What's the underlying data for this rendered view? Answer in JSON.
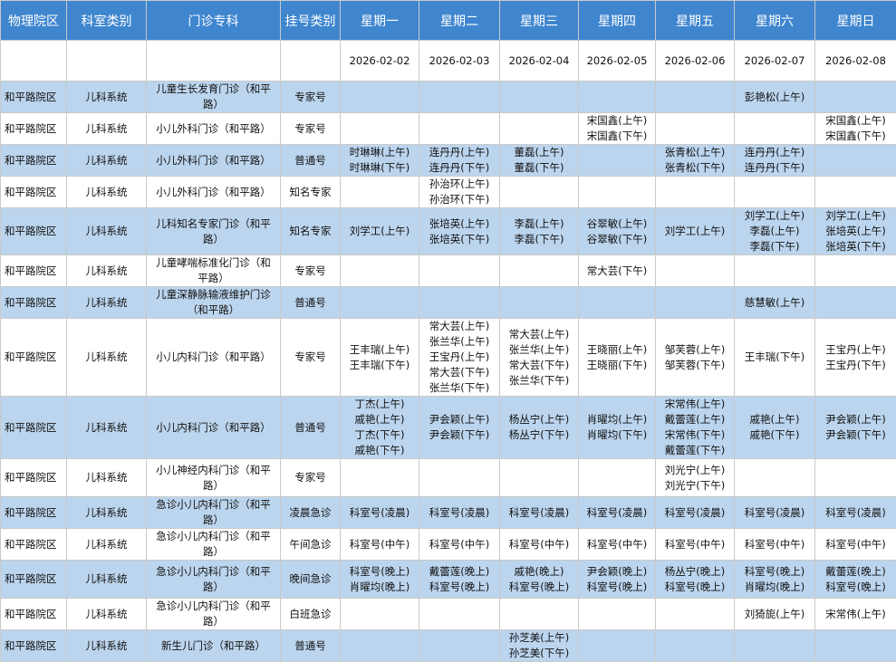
{
  "headers": [
    "物理院区",
    "科室类别",
    "门诊专科",
    "挂号类别",
    "星期一",
    "星期二",
    "星期三",
    "星期四",
    "星期五",
    "星期六",
    "星期日"
  ],
  "dates": [
    "2026-02-02",
    "2026-02-03",
    "2026-02-04",
    "2026-02-05",
    "2026-02-06",
    "2026-02-07",
    "2026-02-08"
  ],
  "rows": [
    {
      "site": "和平路院区",
      "cat": "儿科系统",
      "clinic": "儿童生长发育门诊（和平路）",
      "reg": "专家号",
      "slots": [
        [],
        [],
        [],
        [],
        [],
        [
          "彭艳松(上午)"
        ],
        []
      ]
    },
    {
      "site": "和平路院区",
      "cat": "儿科系统",
      "clinic": "小儿外科门诊（和平路）",
      "reg": "专家号",
      "slots": [
        [],
        [],
        [],
        [
          "宋国鑫(上午)",
          "宋国鑫(下午)"
        ],
        [],
        [],
        [
          "宋国鑫(上午)",
          "宋国鑫(下午)"
        ]
      ]
    },
    {
      "site": "和平路院区",
      "cat": "儿科系统",
      "clinic": "小儿外科门诊（和平路）",
      "reg": "普通号",
      "slots": [
        [
          "时琳琳(上午)",
          "时琳琳(下午)"
        ],
        [
          "连丹丹(上午)",
          "连丹丹(下午)"
        ],
        [
          "董磊(上午)",
          "董磊(下午)"
        ],
        [],
        [
          "张青松(上午)",
          "张青松(下午)"
        ],
        [
          "连丹丹(上午)",
          "连丹丹(下午)"
        ],
        []
      ]
    },
    {
      "site": "和平路院区",
      "cat": "儿科系统",
      "clinic": "小儿外科门诊（和平路）",
      "reg": "知名专家",
      "slots": [
        [],
        [
          "孙治环(上午)",
          "孙治环(下午)"
        ],
        [],
        [],
        [],
        [],
        []
      ]
    },
    {
      "site": "和平路院区",
      "cat": "儿科系统",
      "clinic": "儿科知名专家门诊（和平路）",
      "reg": "知名专家",
      "slots": [
        [
          "刘学工(上午)"
        ],
        [
          "张培英(上午)",
          "张培英(下午)"
        ],
        [
          "李磊(上午)",
          "李磊(下午)"
        ],
        [
          "谷翠敏(上午)",
          "谷翠敏(下午)"
        ],
        [
          "刘学工(上午)"
        ],
        [
          "刘学工(上午)",
          "李磊(上午)",
          "李磊(下午)"
        ],
        [
          "刘学工(上午)",
          "张培英(上午)",
          "张培英(下午)"
        ]
      ]
    },
    {
      "site": "和平路院区",
      "cat": "儿科系统",
      "clinic": "儿童哮喘标准化门诊（和平路）",
      "reg": "专家号",
      "slots": [
        [],
        [],
        [],
        [
          "常大芸(下午)"
        ],
        [],
        [],
        []
      ]
    },
    {
      "site": "和平路院区",
      "cat": "儿科系统",
      "clinic": "儿童深静脉输液维护门诊（和平路）",
      "reg": "普通号",
      "slots": [
        [],
        [],
        [],
        [],
        [],
        [
          "慈慧敏(上午)"
        ],
        []
      ]
    },
    {
      "site": "和平路院区",
      "cat": "儿科系统",
      "clinic": "小儿内科门诊（和平路）",
      "reg": "专家号",
      "slots": [
        [
          "王丰瑞(上午)",
          "王丰瑞(下午)"
        ],
        [
          "常大芸(上午)",
          "张兰华(上午)",
          "王宝丹(上午)",
          "常大芸(下午)",
          "张兰华(下午)"
        ],
        [
          "常大芸(上午)",
          "张兰华(上午)",
          "常大芸(下午)",
          "张兰华(下午)"
        ],
        [
          "王晓丽(上午)",
          "王晓丽(下午)"
        ],
        [
          "邹芙蓉(上午)",
          "邹芙蓉(下午)"
        ],
        [
          "王丰瑞(下午)"
        ],
        [
          "王宝丹(上午)",
          "王宝丹(下午)"
        ]
      ]
    },
    {
      "site": "和平路院区",
      "cat": "儿科系统",
      "clinic": "小儿内科门诊（和平路）",
      "reg": "普通号",
      "slots": [
        [
          "丁杰(上午)",
          "戚艳(上午)",
          "丁杰(下午)",
          "戚艳(下午)"
        ],
        [
          "尹会颖(上午)",
          "尹会颖(下午)"
        ],
        [
          "杨丛宁(上午)",
          "杨丛宁(下午)"
        ],
        [
          "肖曜均(上午)",
          "肖曜均(下午)"
        ],
        [
          "宋常伟(上午)",
          "戴蕾莲(上午)",
          "宋常伟(下午)",
          "戴蕾莲(下午)"
        ],
        [
          "戚艳(上午)",
          "戚艳(下午)"
        ],
        [
          "尹会颖(上午)",
          "尹会颖(下午)"
        ]
      ]
    },
    {
      "site": "和平路院区",
      "cat": "儿科系统",
      "clinic": "小儿神经内科门诊（和平路）",
      "reg": "专家号",
      "slots": [
        [],
        [],
        [],
        [],
        [
          "刘光宁(上午)",
          "刘光宁(下午)"
        ],
        [],
        []
      ]
    },
    {
      "site": "和平路院区",
      "cat": "儿科系统",
      "clinic": "急诊小儿内科门诊（和平路）",
      "reg": "凌晨急诊",
      "slots": [
        [
          "科室号(凌晨)"
        ],
        [
          "科室号(凌晨)"
        ],
        [
          "科室号(凌晨)"
        ],
        [
          "科室号(凌晨)"
        ],
        [
          "科室号(凌晨)"
        ],
        [
          "科室号(凌晨)"
        ],
        [
          "科室号(凌晨)"
        ]
      ]
    },
    {
      "site": "和平路院区",
      "cat": "儿科系统",
      "clinic": "急诊小儿内科门诊（和平路）",
      "reg": "午间急诊",
      "slots": [
        [
          "科室号(中午)"
        ],
        [
          "科室号(中午)"
        ],
        [
          "科室号(中午)"
        ],
        [
          "科室号(中午)"
        ],
        [
          "科室号(中午)"
        ],
        [
          "科室号(中午)"
        ],
        [
          "科室号(中午)"
        ]
      ]
    },
    {
      "site": "和平路院区",
      "cat": "儿科系统",
      "clinic": "急诊小儿内科门诊（和平路）",
      "reg": "晚间急诊",
      "slots": [
        [
          "科室号(晚上)",
          "肖曜均(晚上)"
        ],
        [
          "戴蕾莲(晚上)",
          "科室号(晚上)"
        ],
        [
          "戚艳(晚上)",
          "科室号(晚上)"
        ],
        [
          "尹会颖(晚上)",
          "科室号(晚上)"
        ],
        [
          "杨丛宁(晚上)",
          "科室号(晚上)"
        ],
        [
          "科室号(晚上)",
          "肖曜均(晚上)"
        ],
        [
          "戴蕾莲(晚上)",
          "科室号(晚上)"
        ]
      ]
    },
    {
      "site": "和平路院区",
      "cat": "儿科系统",
      "clinic": "急诊小儿内科门诊（和平路）",
      "reg": "白班急诊",
      "slots": [
        [],
        [],
        [],
        [],
        [],
        [
          "刘猗旎(上午)"
        ],
        [
          "宋常伟(上午)"
        ]
      ]
    },
    {
      "site": "和平路院区",
      "cat": "儿科系统",
      "clinic": "新生儿门诊（和平路）",
      "reg": "普通号",
      "slots": [
        [],
        [],
        [
          "孙芝美(上午)",
          "孙芝美(下午)"
        ],
        [],
        [],
        [],
        []
      ]
    }
  ]
}
